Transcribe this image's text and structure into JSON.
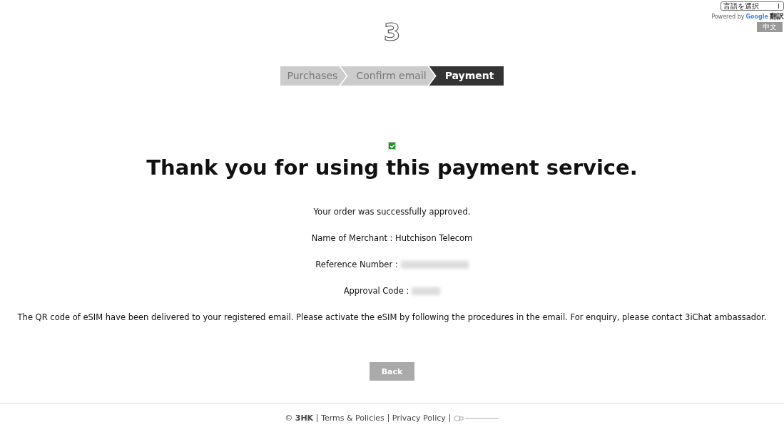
{
  "translate": {
    "select": "言語を選択",
    "powered_by": "Powered by",
    "google": "Google",
    "translate": "翻訳",
    "button": "中文"
  },
  "logo": "3",
  "steps": [
    {
      "label": "Purchases",
      "selected": false
    },
    {
      "label": "Confirm email",
      "selected": false
    },
    {
      "label": "Payment",
      "selected": true
    }
  ],
  "success": {
    "checked": true
  },
  "heading": "Thank you for using this payment service.",
  "lines": [
    {
      "kind": "text",
      "text": "Your order was successfully approved."
    },
    {
      "kind": "text",
      "text": "Name of Merchant : Hutchison Telecom"
    },
    {
      "kind": "redacted",
      "text": "Reference Number :"
    },
    {
      "kind": "redacted",
      "text": "Approval Code :"
    },
    {
      "kind": "text",
      "text": "The QR code of eSIM have been delivered to your registered email. Please activate the eSIM by following the procedures in the email. For enquiry, please contact 3iChat ambassador."
    }
  ],
  "back_button": "Back",
  "footer": {
    "copyright": "© **3HK**",
    "links": [
      "Terms & Policies",
      "Privacy Policy"
    ]
  }
}
